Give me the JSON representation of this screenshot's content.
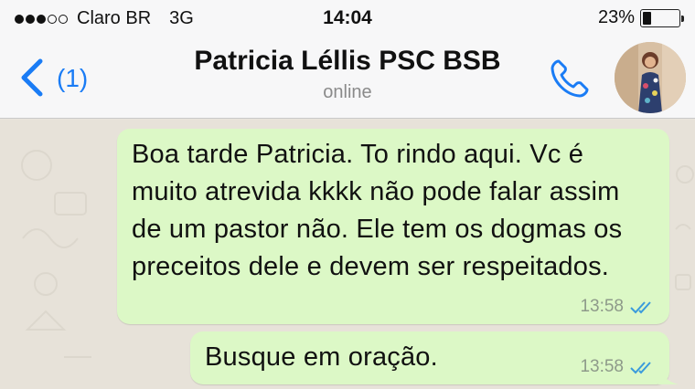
{
  "status_bar": {
    "carrier": "Claro BR",
    "network": "3G",
    "time": "14:04",
    "battery": "23%",
    "battery_level": 0.23,
    "signal_filled": 3,
    "signal_total": 5
  },
  "header": {
    "back_count": "(1)",
    "contact_name": "Patricia Léllis PSC BSB",
    "contact_status": "online",
    "icons": [
      "chevron-left-icon",
      "phone-icon",
      "avatar"
    ],
    "accent_color": "#1a7cf5"
  },
  "messages": [
    {
      "text": "Boa tarde Patricia. To rindo aqui. Vc é muito atrevida kkkk não pode falar assim de um pastor não. Ele tem os dogmas os preceitos dele e devem ser respeitados.",
      "time": "13:58",
      "status": "read"
    },
    {
      "text": "Busque em oração.",
      "time": "13:58",
      "status": "read"
    }
  ],
  "colors": {
    "outgoing_bubble": "#dcf8c6",
    "chat_background": "#e7e2d9",
    "read_ticks": "#3a9bdc"
  }
}
